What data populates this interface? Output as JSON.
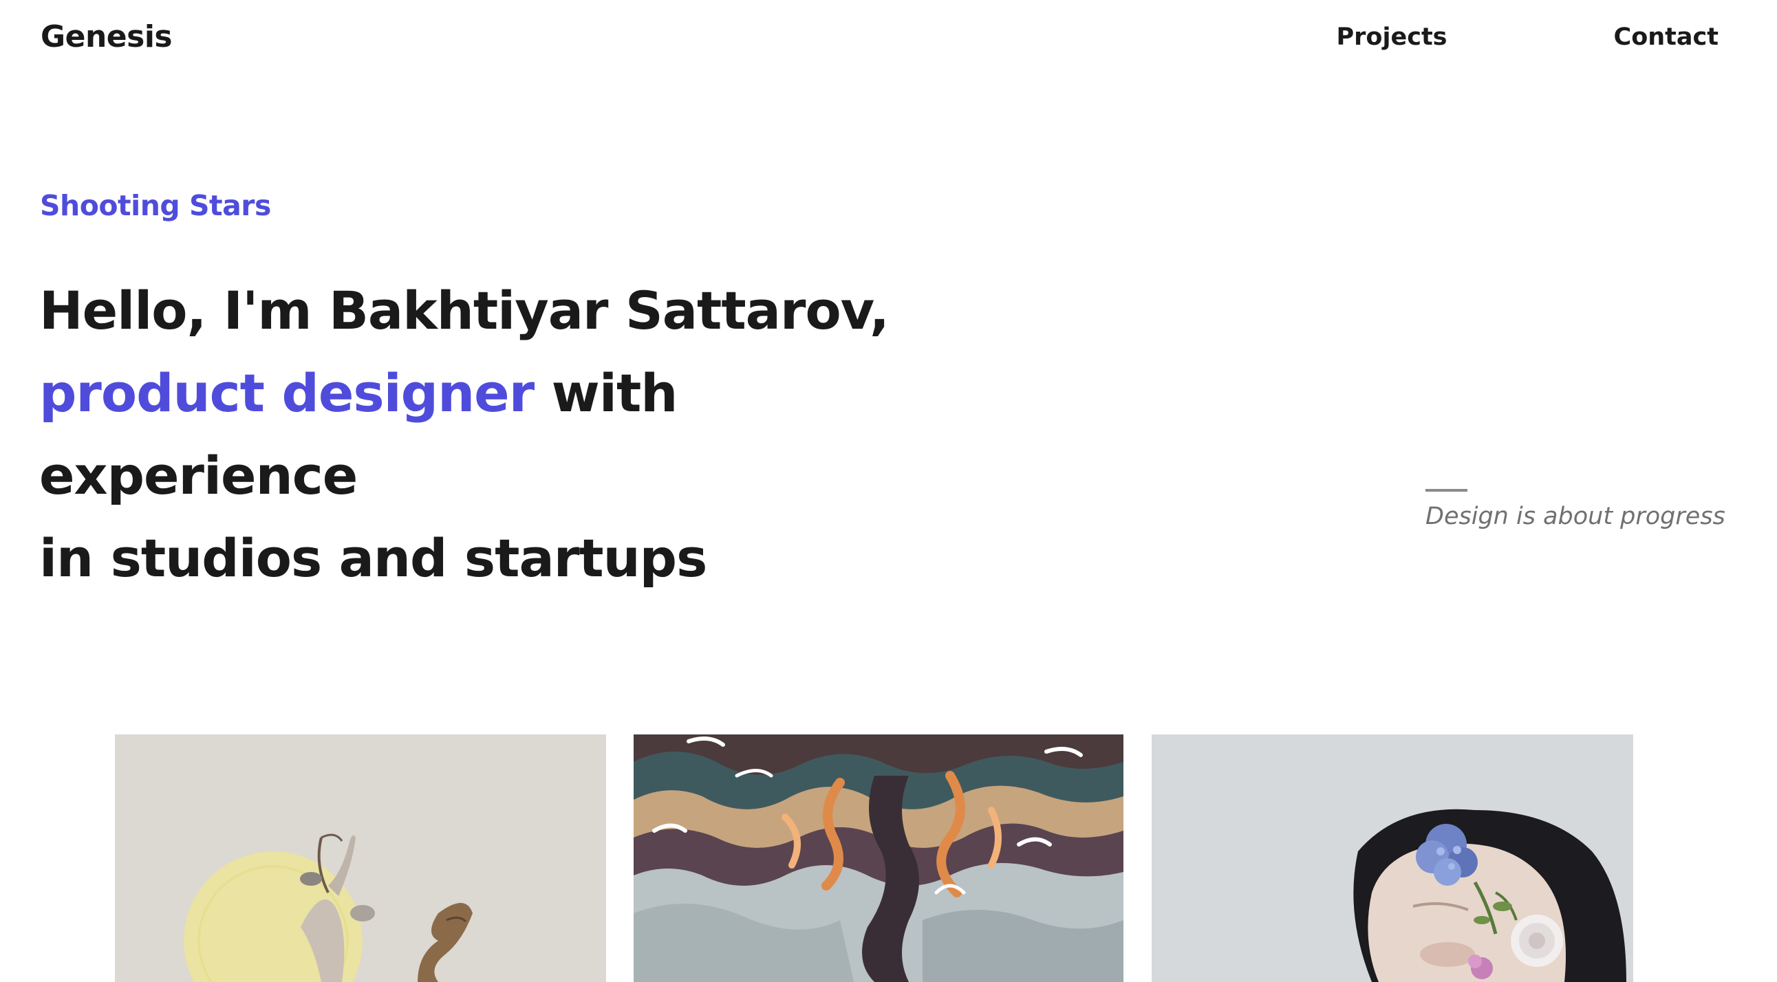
{
  "header": {
    "brand": "Genesis",
    "nav": [
      {
        "label": "Projects"
      },
      {
        "label": "Contact"
      }
    ]
  },
  "hero": {
    "eyebrow": "Shooting Stars",
    "line1": "Hello, I'm Bakhtiyar Sattarov,",
    "line2_accent": "product designer",
    "line2_rest": " with experience",
    "line3": "in studios and startups",
    "tagline": "Design is about progress"
  },
  "colors": {
    "accent": "#4f4cdc",
    "text": "#1a1a1a",
    "muted": "#707070"
  },
  "gallery": {
    "items": [
      {
        "icon": "surreal-archer-artwork"
      },
      {
        "icon": "abstract-wave-tree-artwork"
      },
      {
        "icon": "flower-portrait-photo"
      }
    ]
  }
}
